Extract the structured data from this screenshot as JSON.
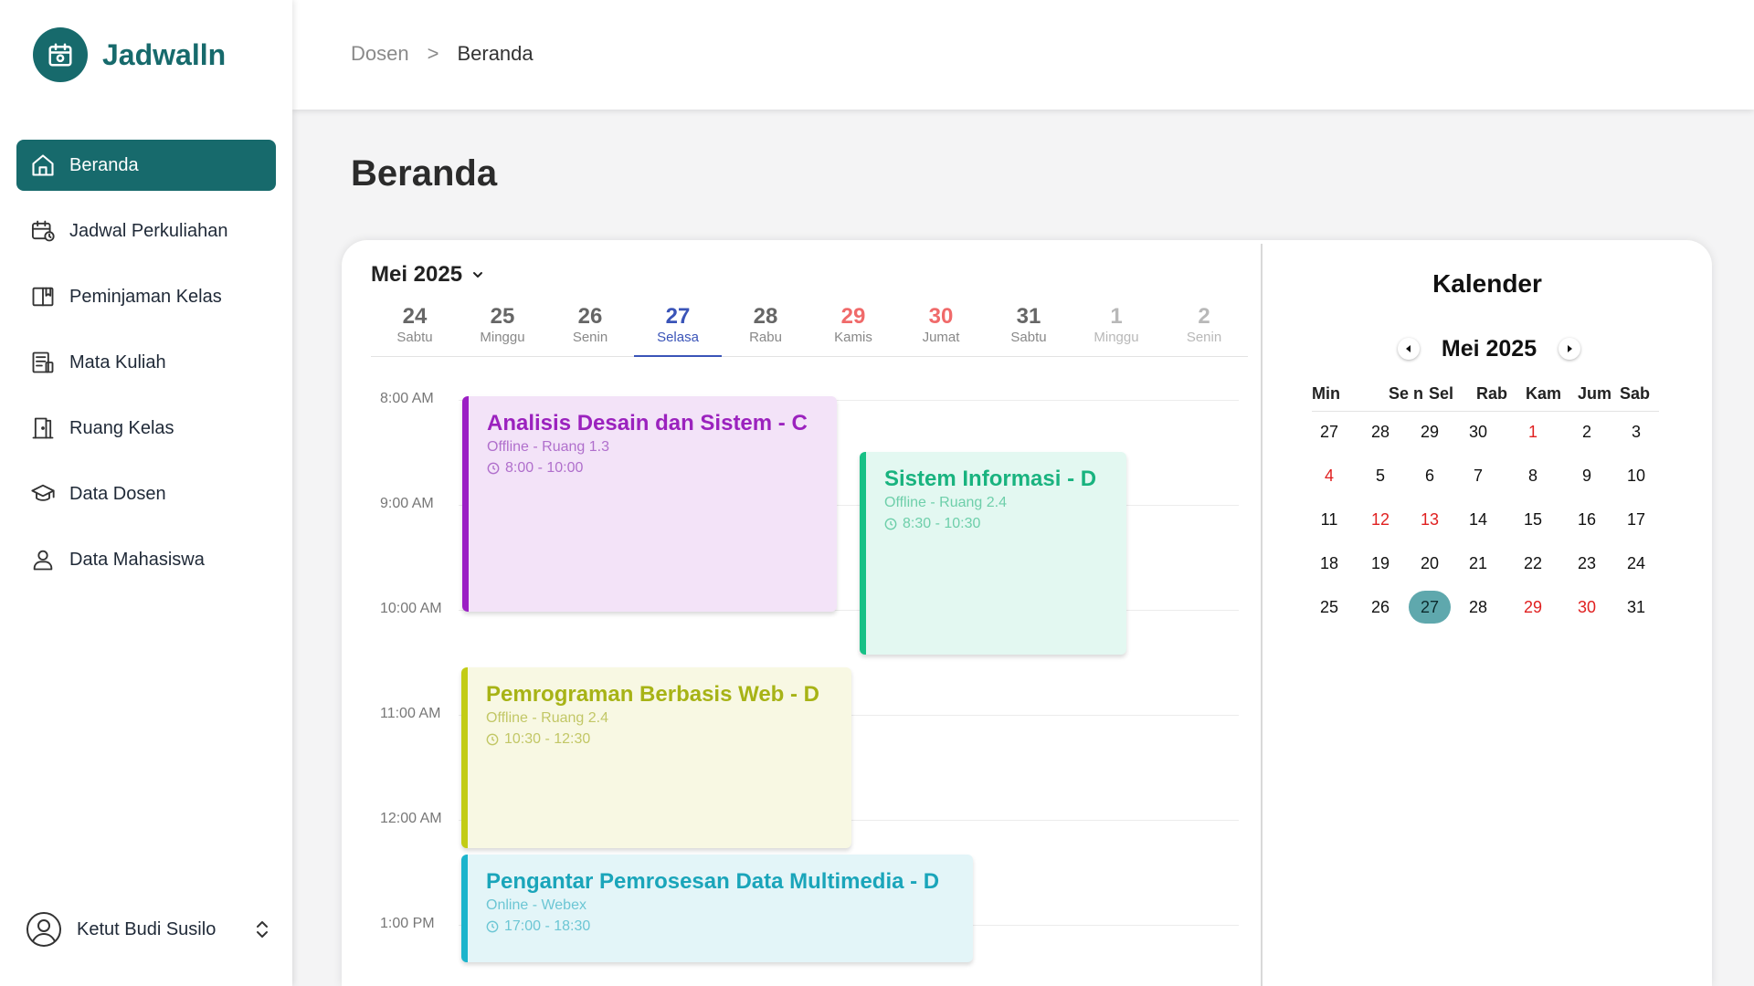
{
  "app": {
    "name": "Jadwalln"
  },
  "sidebar": {
    "items": [
      {
        "label": "Beranda",
        "icon": "home-icon",
        "active": true
      },
      {
        "label": "Jadwal Perkuliahan",
        "icon": "calendar-clock-icon"
      },
      {
        "label": "Peminjaman Kelas",
        "icon": "book-icon"
      },
      {
        "label": "Mata Kuliah",
        "icon": "document-list-icon"
      },
      {
        "label": "Ruang Kelas",
        "icon": "door-icon"
      },
      {
        "label": "Data Dosen",
        "icon": "graduation-cap-icon"
      },
      {
        "label": "Data Mahasiswa",
        "icon": "user-icon"
      }
    ],
    "user": {
      "name": "Ketut Budi Susilo"
    }
  },
  "header": {
    "breadcrumb": [
      "Dosen",
      "Beranda"
    ],
    "separator": ">"
  },
  "page": {
    "title": "Beranda"
  },
  "schedule": {
    "month": "Mei 2025",
    "days": [
      {
        "num": "24",
        "name": "Sabtu"
      },
      {
        "num": "25",
        "name": "Minggu"
      },
      {
        "num": "26",
        "name": "Senin"
      },
      {
        "num": "27",
        "name": "Selasa",
        "active": true
      },
      {
        "num": "28",
        "name": "Rabu"
      },
      {
        "num": "29",
        "name": "Kamis",
        "weekend": true
      },
      {
        "num": "30",
        "name": "Jumat",
        "weekend": true
      },
      {
        "num": "31",
        "name": "Sabtu"
      },
      {
        "num": "1",
        "name": "Minggu",
        "next": true
      },
      {
        "num": "2",
        "name": "Senin",
        "next": true
      }
    ],
    "hours": [
      "8:00 AM",
      "9:00 AM",
      "10:00 AM",
      "11:00 AM",
      "12:00 AM",
      "1:00 PM"
    ],
    "events": [
      {
        "title": "Analisis Desain dan Sistem - C",
        "place": "Offline - Ruang 1.3",
        "time": "8:00 - 10:00",
        "accent": "#9b1fc4",
        "bg": "#f3e3f8",
        "text": "#9b22be",
        "sub": "#b06fcc"
      },
      {
        "title": "Sistem Informasi - D",
        "place": "Offline - Ruang 2.4",
        "time": "8:30 - 10:30",
        "accent": "#17c186",
        "bg": "#e3f8f1",
        "text": "#19b37f",
        "sub": "#6ecfaa"
      },
      {
        "title": "Pemrograman Berbasis Web - D",
        "place": "Offline - Ruang 2.4",
        "time": "10:30 - 12:30",
        "accent": "#c2cc16",
        "bg": "#f8f8e3",
        "text": "#a7b316",
        "sub": "#c2c766"
      },
      {
        "title": "Pengantar Pemrosesan Data Multimedia - D",
        "place": "Online - Webex",
        "time": "17:00 - 18:30",
        "accent": "#1cb4cc",
        "bg": "#e3f5f8",
        "text": "#1aa5ba",
        "sub": "#6cc6d4"
      }
    ]
  },
  "calendar": {
    "title": "Kalender",
    "month": "Mei 2025",
    "weekdays": [
      "Min",
      "Se n",
      "Sel",
      "Rab",
      "Kam",
      "Jum",
      "Sab"
    ],
    "weeks": [
      [
        "27",
        "28",
        "29",
        "30",
        "1",
        "2",
        "3"
      ],
      [
        "4",
        "5",
        "6",
        "7",
        "8",
        "9",
        "10"
      ],
      [
        "11",
        "12",
        "13",
        "14",
        "15",
        "16",
        "17"
      ],
      [
        "18",
        "19",
        "20",
        "21",
        "22",
        "23",
        "24"
      ],
      [
        "25",
        "26",
        "27",
        "28",
        "29",
        "30",
        "31"
      ]
    ],
    "highlight_color": "#5fa8ad",
    "holiday_color": "#e02020"
  },
  "colors": {
    "brand": "#176a6c",
    "active_day": "#3a54b8",
    "weekend_day": "#f06a6a"
  }
}
